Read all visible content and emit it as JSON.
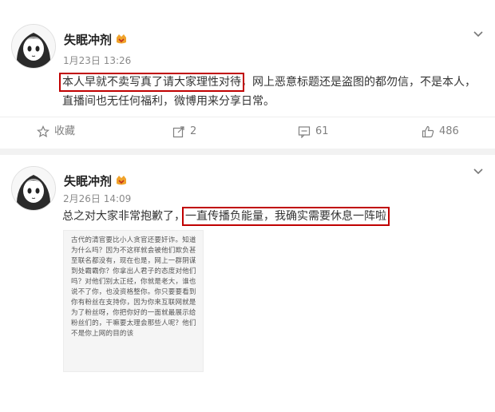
{
  "posts": [
    {
      "username": "失眠冲剂",
      "timestamp": "1月23日 13:26",
      "text_part1": "本人早就不卖写真了请大家理性对待",
      "text_part2": "，网上恶意标题还是盗图的都勿信，不是本人，直播间也无任何福利，微博用来分享日常。",
      "actions": {
        "favorite_label": "收藏",
        "repost_count": "2",
        "comment_count": "61",
        "like_count": "486"
      }
    },
    {
      "username": "失眠冲剂",
      "timestamp": "2月26日 14:09",
      "text_part1": "总之对大家非常抱歉了，",
      "text_part2": "一直传播负能量，我确实需要休息一阵啦",
      "image_text": "古代的清官要比小人贪官还要奸诈。知道为什么吗？因为不这样就会被他们欺负甚至联名都没有，现在也是，网上一群阴谋到处霸霸你？你拿出人君子的态度对他们吗？对他们别太正经，你就是老大，谁也说不了你，也没资格整你。你只要要看到你有粉丝在支持你，因为你来互联网就是为了粉丝呀，你把你好的一面就最展示给粉丝们的，干嘛要太理会那些人呢？他们不是你上网的目的该"
    }
  ],
  "colors": {
    "highlight_box": "#c00000",
    "action_text": "#808080",
    "vip_badge": "#f0a32b"
  },
  "icons": [
    "star-icon",
    "repost-icon",
    "comment-icon",
    "like-icon",
    "chevron-down-icon",
    "vip-badge-icon"
  ]
}
